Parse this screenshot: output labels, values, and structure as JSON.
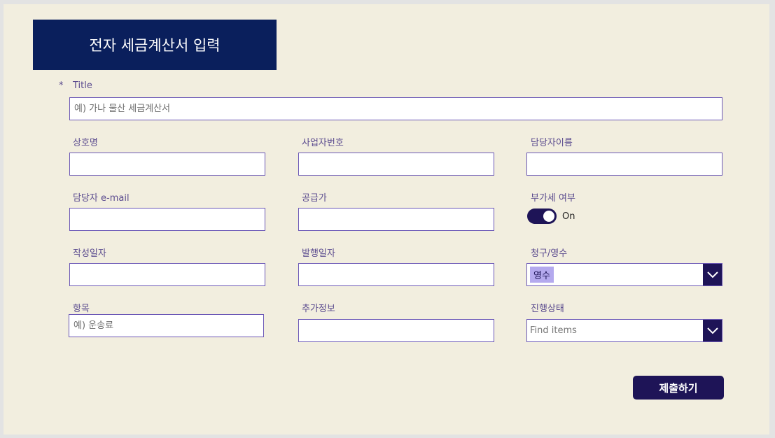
{
  "header": {
    "title": "전자 세금계산서 입력"
  },
  "form": {
    "title_field": {
      "label": "Title",
      "required_mark": "*",
      "placeholder": "예) 가나 물산 세금계산서"
    },
    "company": {
      "label": "상호명",
      "value": ""
    },
    "biz_number": {
      "label": "사업자번호",
      "value": ""
    },
    "contact_name": {
      "label": "담당자이름",
      "value": ""
    },
    "contact_email": {
      "label": "담당자 e-mail",
      "value": ""
    },
    "supply_price": {
      "label": "공급가",
      "value": ""
    },
    "vat": {
      "label": "부가세 여부",
      "state_text": "On",
      "checked": true
    },
    "written_date": {
      "label": "작성일자",
      "value": ""
    },
    "issue_date": {
      "label": "발행일자",
      "value": ""
    },
    "claim_receipt": {
      "label": "청구/영수",
      "selected": "영수"
    },
    "item": {
      "label": "항목",
      "placeholder": "예) 운송료"
    },
    "extra_info": {
      "label": "추가정보",
      "value": ""
    },
    "status": {
      "label": "진행상태",
      "placeholder": "Find items"
    }
  },
  "submit": {
    "label": "제출하기"
  },
  "icons": {
    "dropdown": "chevron-down-icon"
  },
  "colors": {
    "background": "#f2eedf",
    "header": "#0a1f5c",
    "accent": "#1e1457",
    "border": "#6b57b6",
    "chip": "#b4a9ee"
  }
}
